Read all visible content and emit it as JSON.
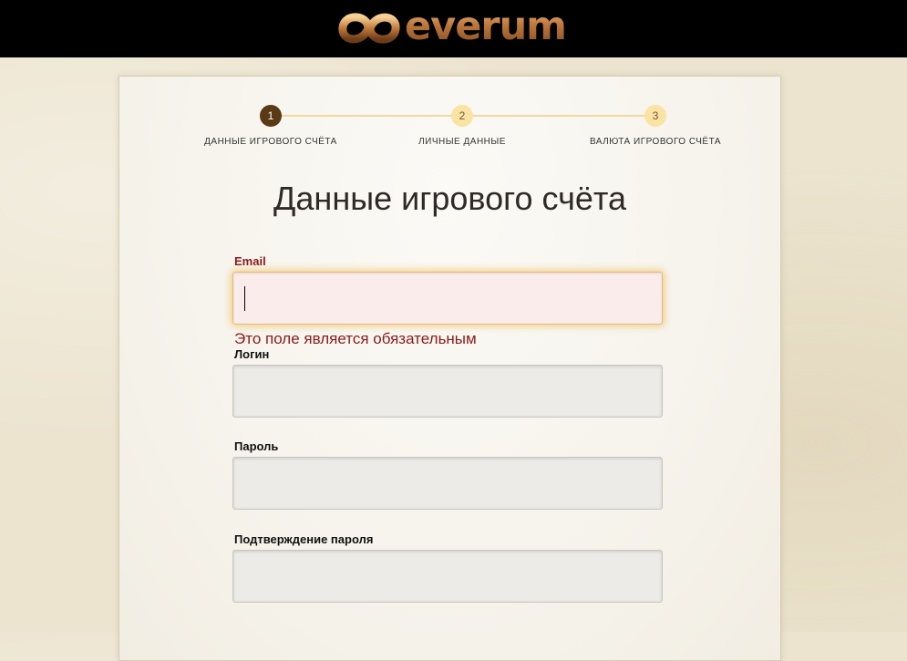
{
  "header": {
    "brand_name": "everum",
    "logo_icon": "everum-swirl-logo",
    "background_color": "#000000",
    "brand_color": "#c07a3c"
  },
  "steps": [
    {
      "number": "1",
      "label": "ДАННЫЕ ИГРОВОГО СЧЁТА",
      "state": "active"
    },
    {
      "number": "2",
      "label": "ЛИЧНЫЕ ДАННЫЕ",
      "state": "inactive"
    },
    {
      "number": "3",
      "label": "ВАЛЮТА ИГРОВОГО СЧЁТА",
      "state": "inactive"
    }
  ],
  "form": {
    "title": "Данные игрового счёта",
    "email": {
      "label": "Email",
      "value": "",
      "error": "Это поле является обязательным"
    },
    "login": {
      "label": "Логин",
      "value": ""
    },
    "password": {
      "label": "Пароль",
      "value": ""
    },
    "password_confirm": {
      "label": "Подтверждение пароля",
      "value": ""
    }
  },
  "colors": {
    "step_active": "#5a3a14",
    "step_inactive": "#fbe3a3",
    "error": "#8b1a1a"
  }
}
